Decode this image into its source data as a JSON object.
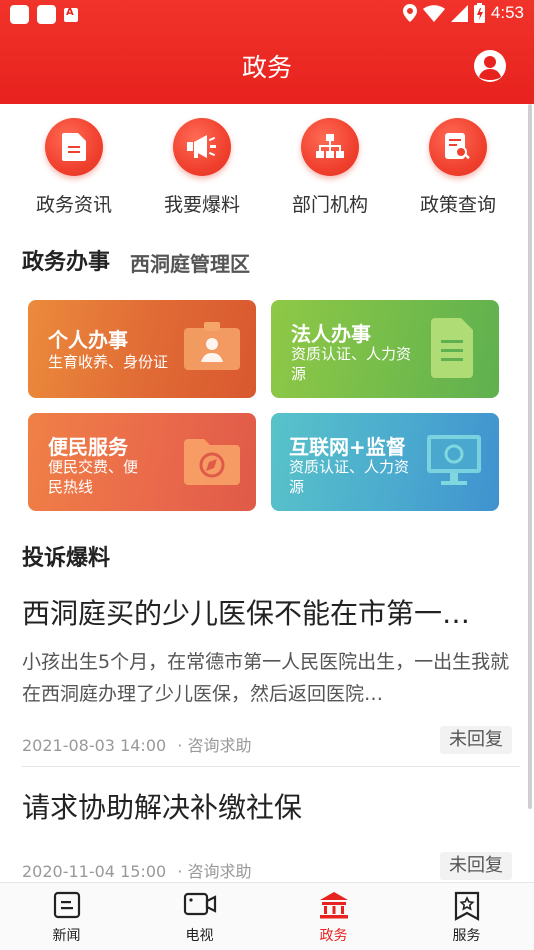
{
  "status_bar": {
    "time": "4:53",
    "keyboard_indicator": "A"
  },
  "header": {
    "title": "政务"
  },
  "quick_links": [
    {
      "label": "政务资讯",
      "icon": "document-icon"
    },
    {
      "label": "我要爆料",
      "icon": "megaphone-icon"
    },
    {
      "label": "部门机构",
      "icon": "org-chart-icon"
    },
    {
      "label": "政策查询",
      "icon": "policy-search-icon"
    }
  ],
  "affairs": {
    "title": "政务办事",
    "region": "西洞庭管理区",
    "cards": [
      {
        "title": "个人办事",
        "subtitle": "生育收养、身份证",
        "icon": "id-card-icon"
      },
      {
        "title": "法人办事",
        "subtitle": "资质认证、人力资源",
        "icon": "file-icon"
      },
      {
        "title": "便民服务",
        "subtitle": "便民交费、便民热线",
        "icon": "compass-folder-icon"
      },
      {
        "title": "互联网+监督",
        "subtitle": "资质认证、人力资源",
        "icon": "monitor-icon"
      }
    ]
  },
  "complaints": {
    "title": "投诉爆料",
    "items": [
      {
        "title": "西洞庭买的少儿医保不能在市第一人民医院报销",
        "body": "小孩出生5个月，在常德市第一人民医院出生，一出生我就在西洞庭办理了少儿医保，然后返回医院…",
        "date": "2021-08-03 14:00",
        "category": "· 咨询求助",
        "status": "未回复"
      },
      {
        "title": "请求协助解决补缴社保",
        "body": "",
        "date": "2020-11-04 15:00",
        "category": "· 咨询求助",
        "status": "未回复"
      }
    ]
  },
  "tabbar": {
    "tabs": [
      {
        "label": "新闻",
        "icon": "news-icon"
      },
      {
        "label": "电视",
        "icon": "tv-camera-icon"
      },
      {
        "label": "政务",
        "icon": "government-building-icon"
      },
      {
        "label": "服务",
        "icon": "service-bookmark-icon"
      }
    ],
    "active": "政务"
  },
  "colors": {
    "brand_red": "#e8221e",
    "card_personal": "#e06a35",
    "card_legal": "#72bb4b",
    "card_convenience": "#e9684b",
    "card_supervision": "#4aa8cf"
  }
}
